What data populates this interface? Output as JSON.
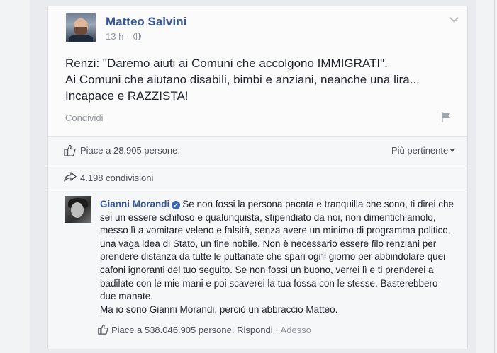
{
  "post": {
    "author": "Matteo Salvini",
    "time": "13 h ·",
    "text_lines": [
      "Renzi: \"Daremo aiuti ai Comuni che accolgono IMMIGRATI\".",
      "Ai Comuni che aiutano disabili, bimbi e anziani, neanche una lira...",
      "Incapace e RAZZISTA!"
    ],
    "share_label": "Condividi"
  },
  "reactions": {
    "likes_label": "Piace a 28.905 persone.",
    "sort_label": "Più pertinente",
    "shares_label": "4.198 condivisioni"
  },
  "comment": {
    "author": "Gianni Morandi",
    "verified_mark": "✓",
    "lines": [
      "Se non fossi la persona pacata e tranquilla che sono, ti direi che",
      "sei un essere schifoso e qualunquista, stipendiato da noi, non dimentichiamolo,",
      "messo lì a vomitare veleno e falsità, senza avere un minimo di programma politico,",
      "una vaga idea di Stato, un fine nobile. Non è necessario essere filo renziani per",
      "prendere distanza da tutte le puttanate che spari ogni giorno per abbindolare quei",
      "cafoni ignoranti del tuo seguito. Se non fossi un buono, verrei lì e ti prenderei a",
      "badilate con le mie mani e poi scaverei la tua fossa con le stesse. Basterebbero",
      "due manate.",
      "Ma io sono Gianni Morandi, perciò un abbraccio Matteo."
    ],
    "likes_label": "Piace a 538.046.905 persone.",
    "reply_label": "Rispondi",
    "separator": " · ",
    "time": "Adesso"
  },
  "colors": {
    "link_blue": "#365899",
    "text_dark": "#1d2129",
    "text_muted": "#90949c",
    "background": "#e9ebee"
  },
  "icons": [
    "globe-icon",
    "chevron-down-icon",
    "flag-icon",
    "like-icon",
    "share-arrow-icon",
    "verified-icon"
  ]
}
